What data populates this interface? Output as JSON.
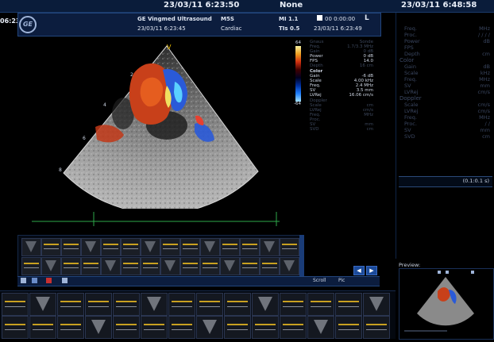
{
  "topbar": {
    "left_time": "23/03/11 6:23:50",
    "status": "None",
    "right_time": "23/03/11 6:48:58"
  },
  "left_time_partial": "06:23:",
  "header": {
    "logo": "GE",
    "line1_left": "GE Vingmed Ultrasound",
    "line2_left": "23/03/11 6:23:45",
    "probe": "M5S",
    "mode": "Cardiac",
    "mi": "MI 1.1",
    "tis": "TIs 0.5",
    "clip_time": "00 0:00:00",
    "clip_date": "23/03/11 6:23:49",
    "orientation": "L"
  },
  "image_params": {
    "scale_top": "64",
    "scale_bottom": "-64",
    "rows_dim_top": [
      {
        "label": "Gnaus",
        "value": "Sonde"
      },
      {
        "label": "Freq.",
        "value": "1.7/3.3 MHz"
      },
      {
        "label": "Gain",
        "value": "0 dB"
      }
    ],
    "rows": [
      {
        "label": "Power",
        "value": "0 dB"
      },
      {
        "label": "FPS",
        "value": "14.0"
      },
      {
        "label": "Depth",
        "value": "16 cm"
      }
    ],
    "color_heading": "Color",
    "color_rows": [
      {
        "label": "Gain",
        "value": "-6 dB"
      },
      {
        "label": "Scale",
        "value": "4.00 kHz"
      },
      {
        "label": "Freq.",
        "value": "2.4 MHz"
      },
      {
        "label": "SV",
        "value": "3.5 mm"
      },
      {
        "label": "LVRej",
        "value": "16.06 cm/s"
      }
    ],
    "dim_rows": [
      {
        "label": "Doppler",
        "value": ""
      },
      {
        "label": "Scale",
        "value": "cm"
      },
      {
        "label": "LVRej",
        "value": "cm/s"
      },
      {
        "label": "Freq.",
        "value": "MHz"
      },
      {
        "label": "Proc.",
        "value": ""
      },
      {
        "label": "SV",
        "value": "mm"
      },
      {
        "label": "SVD",
        "value": "cm"
      }
    ]
  },
  "depth_marks": [
    "2",
    "4",
    "6",
    "8"
  ],
  "right_panel": {
    "rows": [
      {
        "label": "Freq.",
        "value": "MHz"
      },
      {
        "label": "Proc.",
        "value": "/ / / /"
      },
      {
        "label": "Power",
        "value": "dB"
      },
      {
        "label": "FPS",
        "value": ""
      },
      {
        "label": "Depth",
        "value": "cm"
      }
    ],
    "color_heading": "Color",
    "color_rows": [
      {
        "label": "Gain",
        "value": "dB"
      },
      {
        "label": "Scale",
        "value": "kHz"
      },
      {
        "label": "Freq.",
        "value": "MHz"
      },
      {
        "label": "SV",
        "value": "mm"
      },
      {
        "label": "LVRej",
        "value": "cm/s"
      }
    ],
    "doppler_heading": "Doppler",
    "doppler_rows": [
      {
        "label": "Scale",
        "value": "cm/s"
      },
      {
        "label": "LVRej",
        "value": "cm/s"
      },
      {
        "label": "Freq.",
        "value": "MHz"
      },
      {
        "label": "Proc.",
        "value": "/ /"
      },
      {
        "label": "SV",
        "value": "mm"
      },
      {
        "label": "SVD",
        "value": "cm"
      }
    ],
    "zoom": "(0.1:0.1 s)",
    "preview_label": "Preview:"
  },
  "toolbar2": {
    "scroll_label": "Scroll",
    "pic_label": "Pic"
  },
  "thumb_count_top": 28,
  "thumb_count_bottom": 28,
  "colors": {
    "accent": "#0c1d3e",
    "timeline": "#2ea84a",
    "doppler_red": "#d0301a",
    "doppler_blue": "#2a6ad8"
  }
}
